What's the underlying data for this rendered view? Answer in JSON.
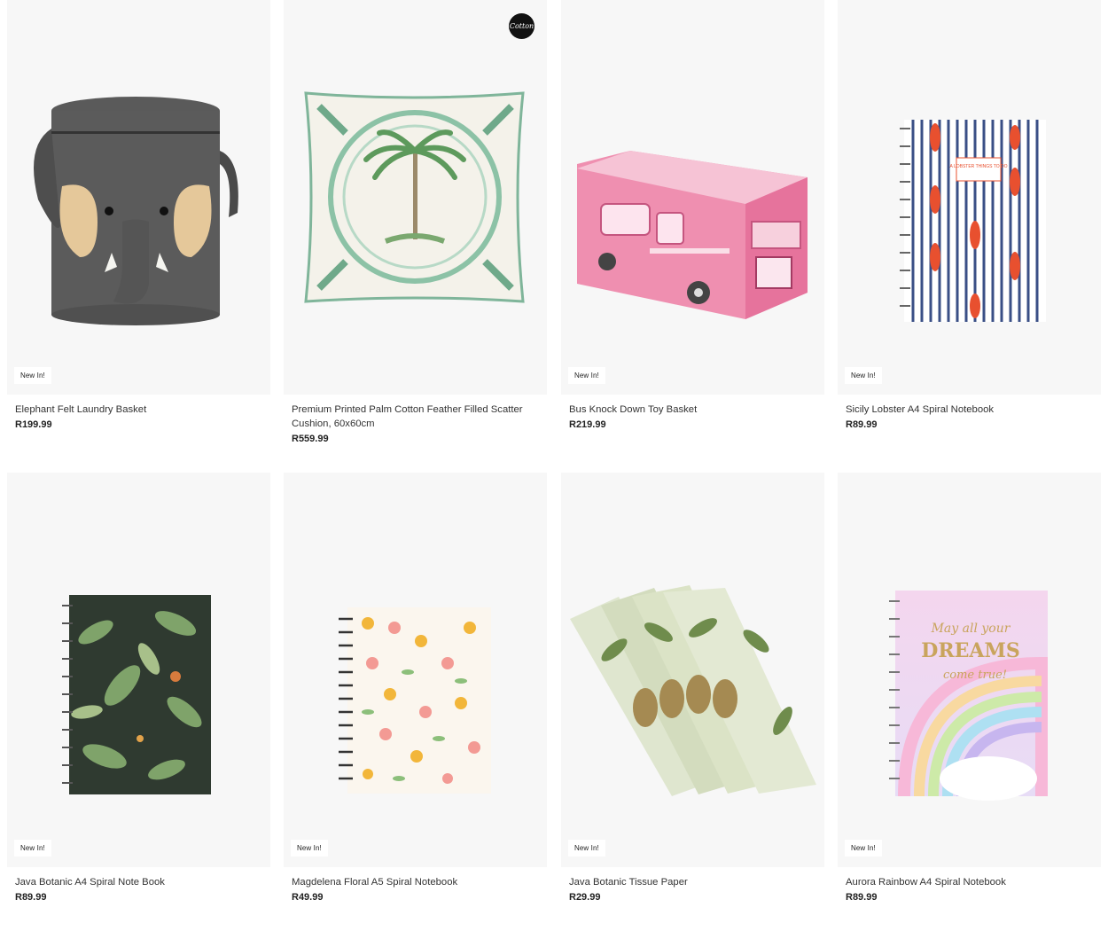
{
  "products": [
    {
      "name": "Elephant Felt Laundry Basket",
      "price": "R199.99",
      "badge": "New In!",
      "image": "elephant-laundry-basket"
    },
    {
      "name": "Premium Printed Palm Cotton Feather Filled Scatter Cushion, 60x60cm",
      "price": "R559.99",
      "badge": "",
      "brand_badge": "Cotton",
      "image": "palm-cushion"
    },
    {
      "name": "Bus Knock Down Toy Basket",
      "price": "R219.99",
      "badge": "New In!",
      "image": "pink-bus-basket"
    },
    {
      "name": "Sicily Lobster A4 Spiral Notebook",
      "price": "R89.99",
      "badge": "New In!",
      "image": "lobster-notebook",
      "cover_text": "A LOBSTER THINGS TO DO"
    },
    {
      "name": "Java Botanic A4 Spiral Note Book",
      "price": "R89.99",
      "badge": "New In!",
      "image": "botanic-notebook"
    },
    {
      "name": "Magdelena Floral A5 Spiral Notebook",
      "price": "R49.99",
      "badge": "New In!",
      "image": "floral-notebook"
    },
    {
      "name": "Java Botanic Tissue Paper",
      "price": "R29.99",
      "badge": "New In!",
      "image": "botanic-tissue-paper"
    },
    {
      "name": "Aurora Rainbow A4 Spiral Notebook",
      "price": "R89.99",
      "badge": "New In!",
      "image": "rainbow-notebook",
      "cover_text": [
        "May all your",
        "DREAMS",
        "come true!"
      ]
    }
  ]
}
